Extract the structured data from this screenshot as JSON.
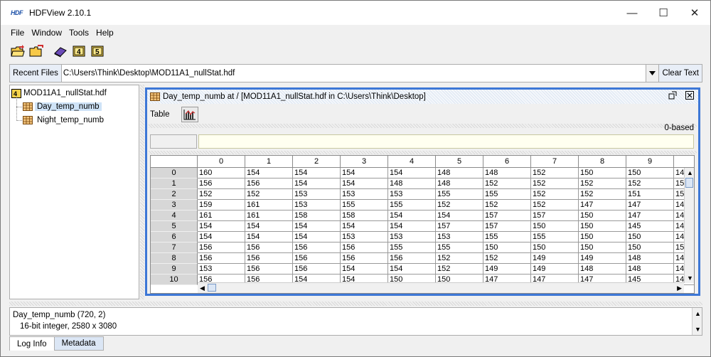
{
  "app": {
    "logo": "HDF",
    "title": "HDFView 2.10.1"
  },
  "window_controls": {
    "minimize": "—",
    "maximize": "☐",
    "close": "✕"
  },
  "menubar": {
    "items": [
      {
        "label": "File"
      },
      {
        "label": "Window"
      },
      {
        "label": "Tools"
      },
      {
        "label": "Help"
      }
    ]
  },
  "toolbar": {
    "icons": [
      "open-folder-icon",
      "open-new-folder-icon",
      "book-icon",
      "hdf4-icon",
      "hdf5-icon"
    ],
    "hdf4_glyph": "4",
    "hdf5_glyph": "5"
  },
  "recent": {
    "button_label": "Recent Files",
    "path_value": "C:\\Users\\Think\\Desktop\\MOD11A1_nullStat.hdf",
    "clear_label": "Clear Text"
  },
  "tree": {
    "root": {
      "label": "MOD11A1_nullStat.hdf",
      "icon": "hdf4-file-icon"
    },
    "children": [
      {
        "label": "Day_temp_numb",
        "icon": "dataset-icon",
        "selected": true
      },
      {
        "label": "Night_temp_numb",
        "icon": "dataset-icon",
        "selected": false
      }
    ]
  },
  "dataset_window": {
    "title": "Day_temp_numb  at  /  [MOD11A1_nullStat.hdf  in  C:\\Users\\Think\\Desktop]",
    "menu_table": "Table",
    "index_base": "0-based",
    "cell_ref": "",
    "cell_value": ""
  },
  "table": {
    "columns": [
      "0",
      "1",
      "2",
      "3",
      "4",
      "5",
      "6",
      "7",
      "8",
      "9",
      ""
    ],
    "rows": [
      {
        "index": "0",
        "cells": [
          "160",
          "154",
          "154",
          "154",
          "154",
          "148",
          "148",
          "152",
          "150",
          "150",
          "14"
        ]
      },
      {
        "index": "1",
        "cells": [
          "156",
          "156",
          "154",
          "154",
          "148",
          "148",
          "152",
          "152",
          "152",
          "152",
          "15"
        ]
      },
      {
        "index": "2",
        "cells": [
          "152",
          "152",
          "153",
          "153",
          "153",
          "155",
          "155",
          "152",
          "152",
          "151",
          "15"
        ]
      },
      {
        "index": "3",
        "cells": [
          "159",
          "161",
          "153",
          "155",
          "155",
          "152",
          "152",
          "152",
          "147",
          "147",
          "14"
        ]
      },
      {
        "index": "4",
        "cells": [
          "161",
          "161",
          "158",
          "158",
          "154",
          "154",
          "157",
          "157",
          "150",
          "147",
          "14"
        ]
      },
      {
        "index": "5",
        "cells": [
          "154",
          "154",
          "154",
          "154",
          "154",
          "157",
          "157",
          "150",
          "150",
          "145",
          "14"
        ]
      },
      {
        "index": "6",
        "cells": [
          "154",
          "154",
          "154",
          "153",
          "153",
          "153",
          "155",
          "155",
          "150",
          "150",
          "14"
        ]
      },
      {
        "index": "7",
        "cells": [
          "156",
          "156",
          "156",
          "156",
          "155",
          "155",
          "150",
          "150",
          "150",
          "150",
          "15"
        ]
      },
      {
        "index": "8",
        "cells": [
          "156",
          "156",
          "156",
          "156",
          "156",
          "152",
          "152",
          "149",
          "149",
          "148",
          "14"
        ]
      },
      {
        "index": "9",
        "cells": [
          "153",
          "156",
          "156",
          "154",
          "154",
          "152",
          "149",
          "149",
          "148",
          "148",
          "14"
        ]
      },
      {
        "index": "10",
        "cells": [
          "156",
          "156",
          "154",
          "154",
          "150",
          "150",
          "147",
          "147",
          "147",
          "145",
          "14"
        ]
      }
    ]
  },
  "info": {
    "line1": "Day_temp_numb (720, 2)",
    "line2": "16-bit integer,    2580 x 3080"
  },
  "tabs": [
    {
      "label": "Log Info",
      "active": true
    },
    {
      "label": "Metadata",
      "active": false
    }
  ],
  "colors": {
    "frame_accent": "#3d77d6",
    "selection": "#cfe3f7",
    "row_header": "#d7d7d7"
  }
}
